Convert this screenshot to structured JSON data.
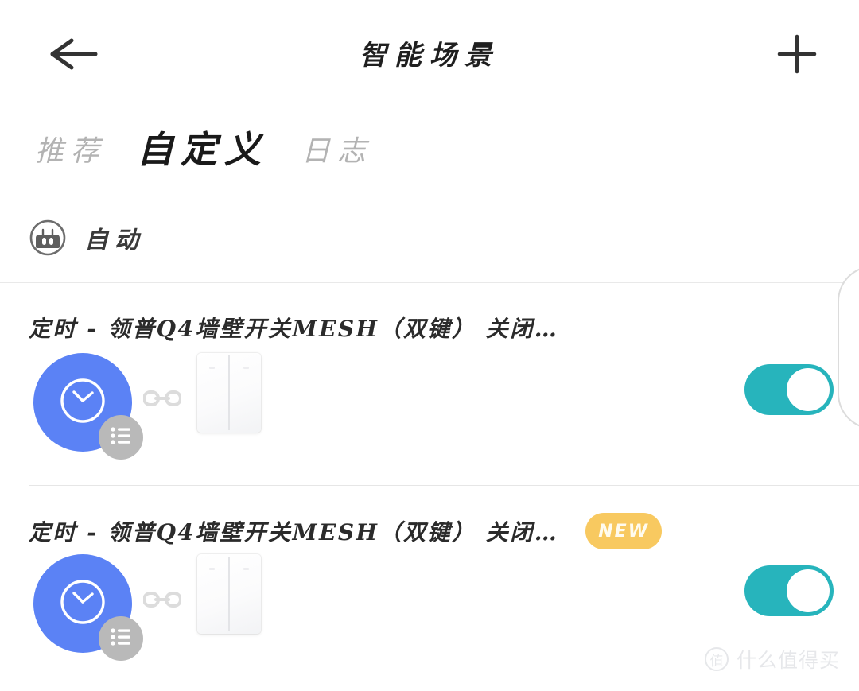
{
  "header": {
    "title": "智能场景",
    "back_icon": "arrow-left-icon",
    "add_icon": "plus-icon"
  },
  "tabs": [
    {
      "label": "推荐",
      "active": false
    },
    {
      "label": "自定义",
      "active": true
    },
    {
      "label": "日志",
      "active": false
    }
  ],
  "section": {
    "label": "自动",
    "icon": "robot-head-icon"
  },
  "scenes": [
    {
      "title": "定时 - 领普Q4墙壁开关MESH（双键） 关闭…",
      "badge": "",
      "has_badge": false,
      "trigger_icon": "clock-icon",
      "trigger_color": "#5b82f5",
      "action_badge_icon": "list-icon",
      "link_icon": "chain-link-icon",
      "device_icon": "wall-switch-dual-key",
      "toggle_on": true,
      "toggle_color": "#27b4bc"
    },
    {
      "title": "定时 - 领普Q4墙壁开关MESH（双键） 关闭…",
      "badge": "NEW",
      "has_badge": true,
      "trigger_icon": "clock-icon",
      "trigger_color": "#5b82f5",
      "action_badge_icon": "list-icon",
      "link_icon": "chain-link-icon",
      "device_icon": "wall-switch-dual-key",
      "toggle_on": true,
      "toggle_color": "#27b4bc"
    }
  ],
  "watermark": {
    "mark": "值",
    "text": "什么值得买"
  },
  "colors": {
    "accent_blue": "#5b82f5",
    "toggle_teal": "#27b4bc",
    "badge_yellow": "#f8c960",
    "divider": "#e9e9e9",
    "text_primary": "#1f1f1f",
    "text_muted": "#b3b3b3"
  }
}
